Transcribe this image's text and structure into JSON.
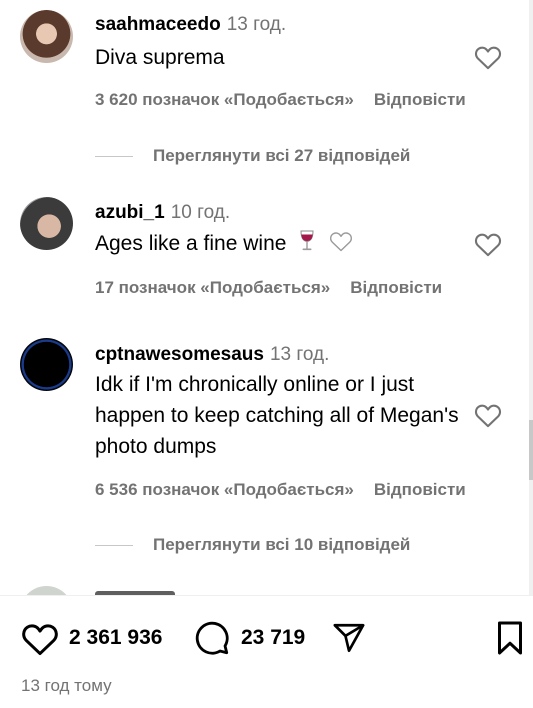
{
  "comments": [
    {
      "username": "saahmaceedo",
      "time": "13 год.",
      "text": "Diva suprema",
      "likes": "3 620 позначок «Подобається»",
      "reply": "Відповісти",
      "view_replies": "Переглянути всі 27 відповідей"
    },
    {
      "username": "azubi_1",
      "time": "10 год.",
      "text": "Ages like a fine wine",
      "likes": "17 позначок «Подобається»",
      "reply": "Відповісти"
    },
    {
      "username": "cptnawesomesaus",
      "time": "13 год.",
      "text": "Idk if I'm chronically online or I just happen to keep catching all of Megan's photo dumps",
      "likes": "6 536 позначок «Подобається»",
      "reply": "Відповісти",
      "view_replies": "Переглянути всі 10 відповідей"
    }
  ],
  "footer": {
    "like_count": "2 361 936",
    "comment_count": "23 719",
    "posted": "13 год тому"
  },
  "icons": {
    "heart": "heart-icon",
    "comment": "comment-icon",
    "share": "share-icon",
    "save": "bookmark-icon",
    "wine": "wine-glass-emoji",
    "white_heart": "white-heart-emoji"
  }
}
